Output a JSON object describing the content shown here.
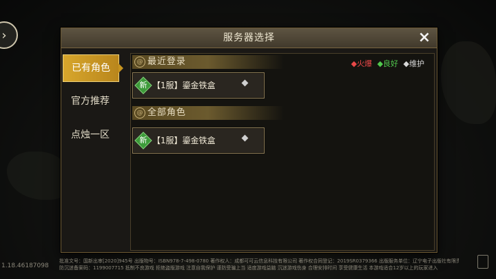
{
  "dialog": {
    "title": "服务器选择",
    "close_icon": "×"
  },
  "sidebar": {
    "items": [
      {
        "label": "已有角色",
        "active": true
      },
      {
        "label": "官方推荐",
        "active": false
      },
      {
        "label": "点烛一区",
        "active": false
      }
    ]
  },
  "sections": [
    {
      "label": "最近登录",
      "servers": [
        {
          "name": "新【1服】鎏金铁盒",
          "badge": "新",
          "label": "【1服】鎏金铁盒"
        }
      ]
    },
    {
      "label": "全部角色",
      "servers": [
        {
          "name": "新【1服】鎏金铁盒",
          "badge": "新",
          "label": "【1服】鎏金铁盒"
        }
      ]
    }
  ],
  "legend": {
    "hot": "火爆",
    "good": "良好",
    "maintenance": "维护",
    "colors": {
      "hot": "#e84848",
      "good": "#51c84e",
      "maintenance": "#d8d8d8"
    }
  },
  "footer": {
    "line1": "批准文号：国新出审[2020]945号  出版物号：ISBN978-7-498-0780  著作权人：成都可可云信息科技有限公司  著作权合同登记：2019SR0379366  出版服务单位：辽宁电子出版社有限责任公司",
    "line2": "防沉迷备案码：1199007715  抵制不良游戏  拒绝盗版游戏  注意自我保护  谨防受骗上当  适度游戏益脑  沉迷游戏伤身  合理安排时间  享受健康生活  本游戏适合12岁以上的玩家进入",
    "version": "1.18.46187098"
  }
}
